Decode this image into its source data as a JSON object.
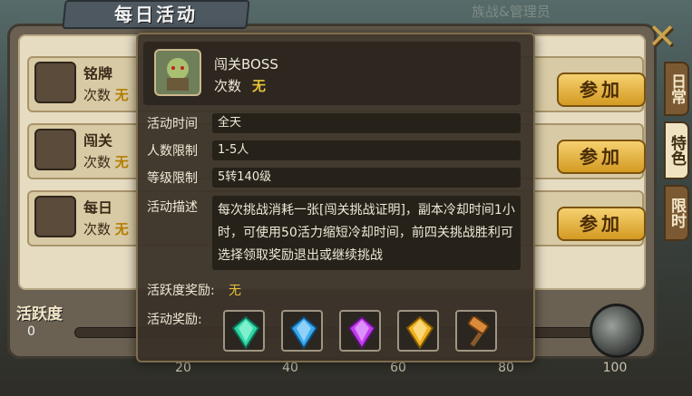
{
  "window": {
    "title": "每日活动",
    "faded_top_text": "族战&管理员"
  },
  "tabs": [
    {
      "label": "日常",
      "active": false
    },
    {
      "label": "特色",
      "active": true
    },
    {
      "label": "限时",
      "active": false
    }
  ],
  "rows": [
    {
      "name": "铭牌BOSS",
      "count_label": "次数",
      "count_value": "无",
      "join_label": "参加"
    },
    {
      "name": "闯关BOSS",
      "count_label": "次数",
      "count_value": "无",
      "join_label": "参加"
    },
    {
      "name": "每日BOSS",
      "count_label": "次数",
      "count_value": "无",
      "join_label": "参加"
    }
  ],
  "activity": {
    "label": "活跃度",
    "value": "0",
    "progress_fraction": 0,
    "ticks": [
      "20",
      "40",
      "60",
      "80",
      "100"
    ]
  },
  "popup": {
    "title": "闯关BOSS",
    "count_label": "次数",
    "count_value": "无",
    "fields": [
      {
        "label": "活动时间",
        "value": "全天"
      },
      {
        "label": "人数限制",
        "value": "1-5人"
      },
      {
        "label": "等级限制",
        "value": "5转140级"
      }
    ],
    "desc_label": "活动描述",
    "description": "每次挑战消耗一张[闯关挑战证明]，副本冷却时间1小时，可使用50活力缩短冷却时间，前四关挑战胜利可选择领取奖励退出或继续挑战",
    "activity_reward_label": "活跃度奖励:",
    "activity_reward_value": "无",
    "rewards_label": "活动奖励:",
    "rewards": [
      {
        "icon": "green-gem-icon",
        "color": "#31d6a5"
      },
      {
        "icon": "blue-gem-icon",
        "color": "#3aa8f0"
      },
      {
        "icon": "purple-gem-icon",
        "color": "#c23cf0"
      },
      {
        "icon": "gold-gem-icon",
        "color": "#f0b21e"
      },
      {
        "icon": "hammer-icon",
        "color": "#d98a3a"
      }
    ]
  },
  "colors": {
    "accent_gold": "#e8c23a",
    "button_gold": "#f6d170"
  }
}
